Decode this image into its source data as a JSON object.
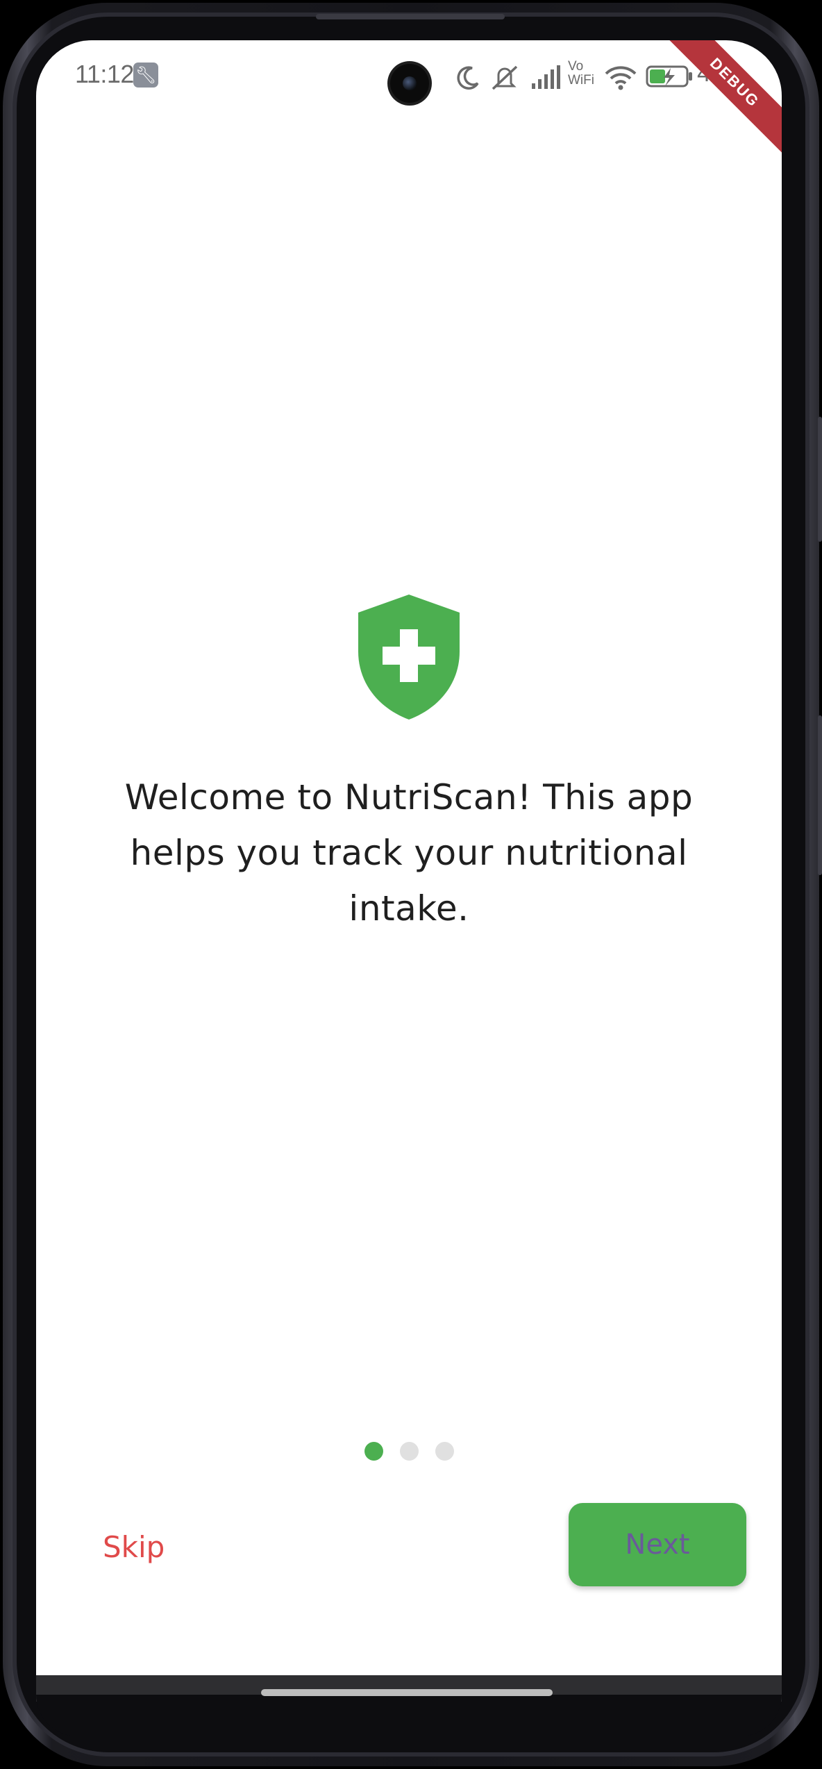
{
  "status_bar": {
    "time": "11:12",
    "battery_percent": "46",
    "icons": [
      "wrench-icon",
      "moon-icon",
      "mute-icon",
      "signal-icon",
      "vowifi-icon",
      "wifi-icon",
      "battery-charging-icon"
    ],
    "vowifi_label_top": "Vo",
    "vowifi_label_bottom": "WiFi"
  },
  "debug_banner": "DEBUG",
  "onboarding": {
    "icon": "shield-plus-icon",
    "message": "Welcome to NutriScan! This app helps you track your nutritional intake.",
    "page_index": 1,
    "page_count": 3,
    "skip_label": "Skip",
    "next_label": "Next"
  },
  "colors": {
    "accent_green": "#4caf50",
    "skip_red": "#e04a4a",
    "next_text": "#6a5a9a",
    "dot_inactive": "#e0e0e0",
    "debug_red": "#b5353c"
  }
}
